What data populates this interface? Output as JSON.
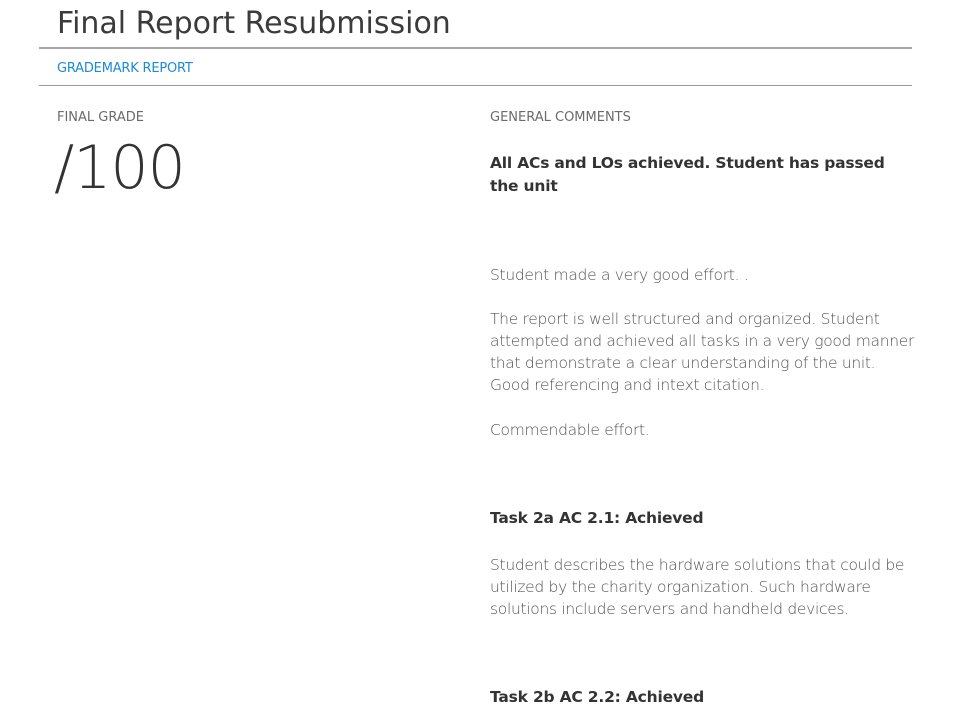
{
  "header": {
    "title": "Final Report Resubmission",
    "report_link": "GRADEMARK REPORT"
  },
  "grade": {
    "label": "FINAL GRADE",
    "value": "/100"
  },
  "comments": {
    "label": "GENERAL COMMENTS",
    "summary": "All ACs and LOs achieved. Student has passed the unit",
    "paragraphs": [
      "Student made a very good effort.  .",
      "The report is well structured and organized. Student attempted and achieved all tasks in a very good manner that demonstrate a clear understanding of the unit. Good referencing and intext citation.",
      "Commendable effort."
    ],
    "tasks": [
      {
        "heading": "Task 2a AC 2.1: Achieved",
        "text": "Student describes the hardware solutions that could be utilized by the charity organization. Such hardware solutions include servers and handheld devices."
      },
      {
        "heading": "Task 2b AC 2.2: Achieved"
      }
    ]
  },
  "colors": {
    "link": "#1a8bd6",
    "title": "#3b3b3b",
    "rule": "#a6a6a6"
  }
}
